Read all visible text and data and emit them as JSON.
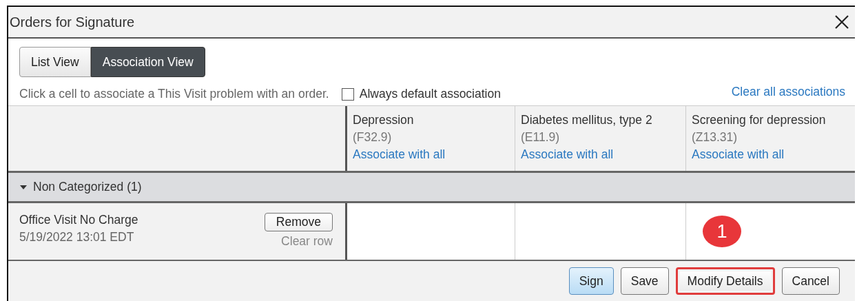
{
  "window": {
    "title": "Orders for Signature"
  },
  "view_toggle": [
    {
      "label": "List View",
      "selected": false
    },
    {
      "label": "Association View",
      "selected": true
    }
  ],
  "instruction": "Click a cell to associate a This Visit problem with an order.",
  "always_default": {
    "label": "Always default association",
    "checked": false
  },
  "clear_all_link": "Clear all associations",
  "problems": [
    {
      "name": "Depression",
      "code": "(F32.9)",
      "link": "Associate with all"
    },
    {
      "name": "Diabetes mellitus, type 2",
      "code": "(E11.9)",
      "link": "Associate with all"
    },
    {
      "name": "Screening for depression",
      "code": "(Z13.31)",
      "link": "Associate with all"
    }
  ],
  "groups": [
    {
      "label": "Non Categorized (1)",
      "expanded": true,
      "orders": [
        {
          "name": "Office Visit No Charge",
          "date": "5/19/2022 13:01 EDT",
          "remove_button": "Remove",
          "clear_row": "Clear row",
          "cells": [
            {
              "associated": false
            },
            {
              "associated": false
            },
            {
              "associated": false,
              "badge": "1"
            }
          ]
        }
      ]
    }
  ],
  "buttons": [
    {
      "label": "Sign",
      "kind": "primary",
      "highlighted": false
    },
    {
      "label": "Save",
      "kind": "normal",
      "highlighted": false
    },
    {
      "label": "Modify Details",
      "kind": "normal",
      "highlighted": true
    },
    {
      "label": "Cancel",
      "kind": "normal",
      "highlighted": false
    }
  ]
}
